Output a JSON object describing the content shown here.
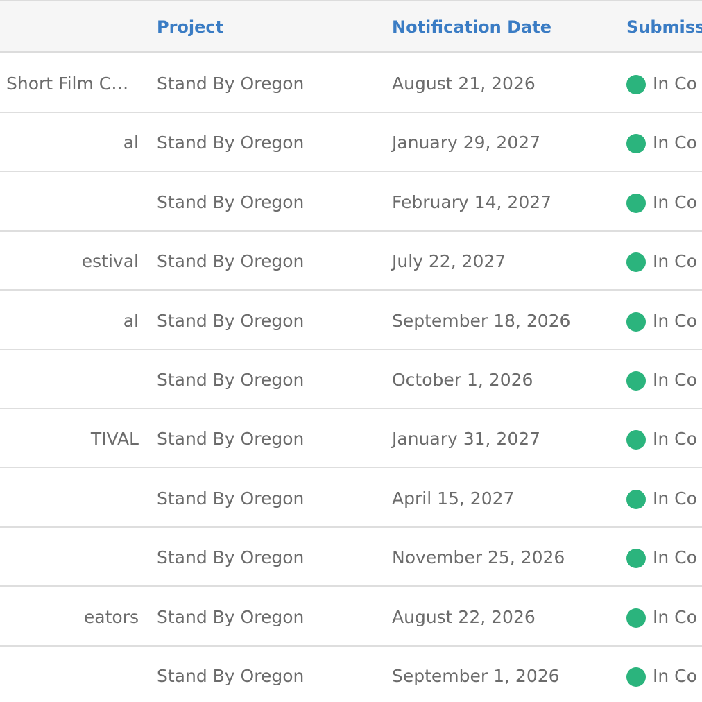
{
  "colors": {
    "header_text": "#3a7cc4",
    "cell_text": "#6b6b6b",
    "status_dot": "#2bb47d"
  },
  "table": {
    "columns": {
      "project": "Project",
      "notification_date": "Notification Date",
      "submission": "Submiss"
    },
    "rows": [
      {
        "name": "Short Film C…",
        "project": "Stand By Oregon",
        "date": "August 21, 2026",
        "status": "In Co"
      },
      {
        "name": "al",
        "project": "Stand By Oregon",
        "date": "January 29, 2027",
        "status": "In Co"
      },
      {
        "name": "",
        "project": "Stand By Oregon",
        "date": "February 14, 2027",
        "status": "In Co"
      },
      {
        "name": "estival",
        "project": "Stand By Oregon",
        "date": "July 22, 2027",
        "status": "In Co"
      },
      {
        "name": "al",
        "project": "Stand By Oregon",
        "date": "September 18, 2026",
        "status": "In Co"
      },
      {
        "name": "",
        "project": "Stand By Oregon",
        "date": "October 1, 2026",
        "status": "In Co"
      },
      {
        "name": "TIVAL",
        "project": "Stand By Oregon",
        "date": "January 31, 2027",
        "status": "In Co"
      },
      {
        "name": "",
        "project": "Stand By Oregon",
        "date": "April 15, 2027",
        "status": "In Co"
      },
      {
        "name": "",
        "project": "Stand By Oregon",
        "date": "November 25, 2026",
        "status": "In Co"
      },
      {
        "name": "eators",
        "project": "Stand By Oregon",
        "date": "August 22, 2026",
        "status": "In Co"
      },
      {
        "name": "",
        "project": "Stand By Oregon",
        "date": "September 1, 2026",
        "status": "In Co"
      }
    ]
  }
}
